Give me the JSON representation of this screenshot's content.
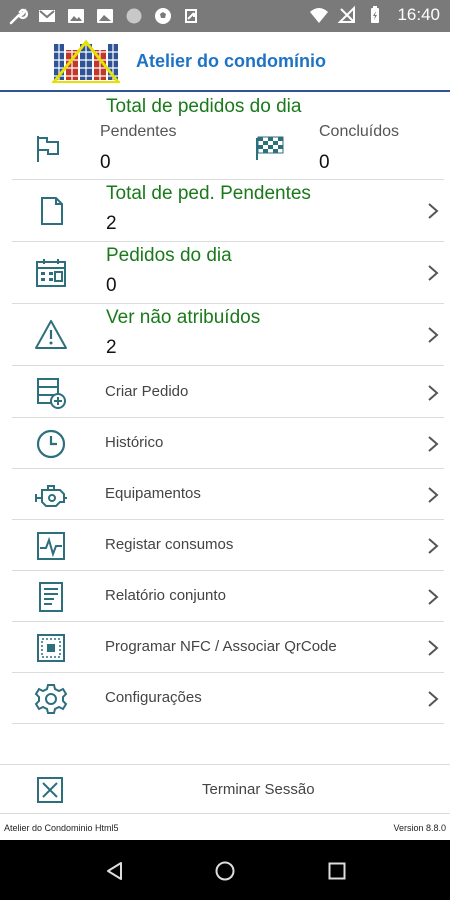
{
  "status_bar": {
    "time": "16:40"
  },
  "app": {
    "title": "Atelier do condomínio"
  },
  "summary": {
    "title": "Total de pedidos do dia",
    "pending_label": "Pendentes",
    "pending_value": "0",
    "done_label": "Concluídos",
    "done_value": "0"
  },
  "stats": [
    {
      "label": "Total de ped. Pendentes",
      "value": "2",
      "icon": "document-icon"
    },
    {
      "label": "Pedidos do dia",
      "value": "0",
      "icon": "calendar-icon"
    },
    {
      "label": "Ver não atribuídos",
      "value": "2",
      "icon": "warning-icon"
    }
  ],
  "menu": [
    {
      "label": "Criar Pedido",
      "icon": "create-order-icon"
    },
    {
      "label": "Histórico",
      "icon": "clock-icon"
    },
    {
      "label": "Equipamentos",
      "icon": "engine-icon"
    },
    {
      "label": "Registar consumos",
      "icon": "pulse-icon"
    },
    {
      "label": "Relatório conjunto",
      "icon": "report-icon"
    },
    {
      "label": "Programar NFC / Associar QrCode",
      "icon": "nfc-icon"
    },
    {
      "label": "Configurações",
      "icon": "gear-icon"
    }
  ],
  "logout": {
    "label": "Terminar Sessão"
  },
  "footer": {
    "left": "Atelier do Condominio Html5",
    "right": "Version 8.8.0"
  },
  "colors": {
    "accent_blue": "#1e73c4",
    "green": "#1a7a1a",
    "icon_teal": "#2e6f7e"
  }
}
